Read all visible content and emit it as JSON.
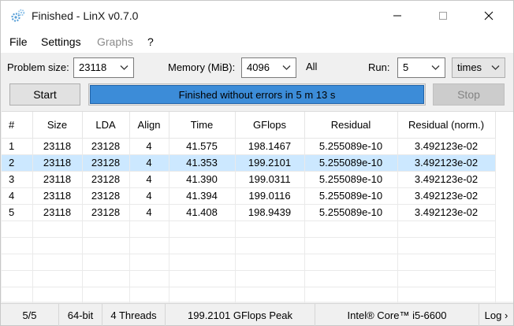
{
  "window": {
    "title": "Finished - LinX v0.7.0",
    "icon": "gear-cogs-icon"
  },
  "menu": {
    "file": "File",
    "settings": "Settings",
    "graphs": "Graphs",
    "help": "?"
  },
  "options": {
    "problem_size_label": "Problem size:",
    "problem_size_value": "23118",
    "memory_label": "Memory (MiB):",
    "memory_value": "4096",
    "all_label": "All",
    "run_label": "Run:",
    "run_value": "5",
    "run_unit": "times"
  },
  "controls": {
    "start_label": "Start",
    "stop_label": "Stop",
    "progress_text": "Finished without errors in 5 m 13 s",
    "progress_fraction": 1.0
  },
  "table": {
    "headers": [
      "#",
      "Size",
      "LDA",
      "Align",
      "Time",
      "GFlops",
      "Residual",
      "Residual (norm.)"
    ],
    "rows": [
      [
        "1",
        "23118",
        "23128",
        "4",
        "41.575",
        "198.1467",
        "5.255089e-10",
        "3.492123e-02"
      ],
      [
        "2",
        "23118",
        "23128",
        "4",
        "41.353",
        "199.2101",
        "5.255089e-10",
        "3.492123e-02"
      ],
      [
        "3",
        "23118",
        "23128",
        "4",
        "41.390",
        "199.0311",
        "5.255089e-10",
        "3.492123e-02"
      ],
      [
        "4",
        "23118",
        "23128",
        "4",
        "41.394",
        "199.0116",
        "5.255089e-10",
        "3.492123e-02"
      ],
      [
        "5",
        "23118",
        "23128",
        "4",
        "41.408",
        "198.9439",
        "5.255089e-10",
        "3.492123e-02"
      ]
    ],
    "selected_row": 2
  },
  "status": {
    "progress": "5/5",
    "arch": "64-bit",
    "threads": "4 Threads",
    "peak": "199.2101 GFlops Peak",
    "cpu": "Intel® Core™ i5-6600",
    "log": "Log ›"
  },
  "colors": {
    "progress_fill": "#3c8cd8",
    "selected_row": "#cce8ff"
  }
}
